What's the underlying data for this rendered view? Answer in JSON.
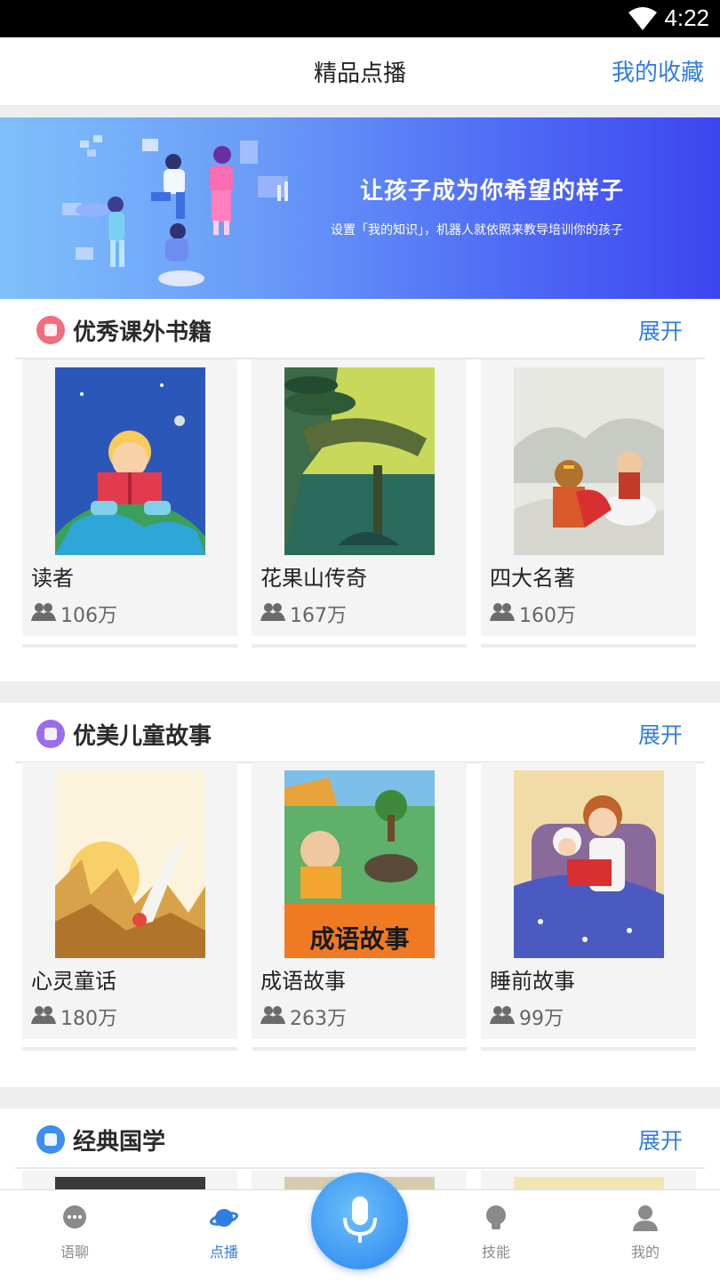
{
  "status_bar": {
    "time": "4:22"
  },
  "header": {
    "title": "精品点播",
    "favorites_label": "我的收藏"
  },
  "banner": {
    "headline": "让孩子成为你希望的样子",
    "subtitle": "设置「我的知识」，机器人就依照来教导培训你的孩子"
  },
  "sections": [
    {
      "title": "优秀课外书籍",
      "more_label": "展开",
      "icon_color": "#f26d7d",
      "items": [
        {
          "name": "读者",
          "count": "106万"
        },
        {
          "name": "花果山传奇",
          "count": "167万"
        },
        {
          "name": "四大名著",
          "count": "160万"
        }
      ]
    },
    {
      "title": "优美儿童故事",
      "more_label": "展开",
      "icon_color": "#9b6cf0",
      "items": [
        {
          "name": "心灵童话",
          "count": "180万"
        },
        {
          "name": "成语故事",
          "count": "263万",
          "cover_text": "成语故事"
        },
        {
          "name": "睡前故事",
          "count": "99万"
        }
      ]
    },
    {
      "title": "经典国学",
      "more_label": "展开",
      "icon_color": "#3d8ef0"
    }
  ],
  "bottom_nav": {
    "items": [
      {
        "label": "语聊",
        "icon": "chat-bubble-icon",
        "active": false
      },
      {
        "label": "点播",
        "icon": "planet-icon",
        "active": true
      },
      {
        "label": "技能",
        "icon": "lightbulb-icon",
        "active": false
      },
      {
        "label": "我的",
        "icon": "person-icon",
        "active": false
      }
    ],
    "center_button": {
      "icon": "microphone-icon"
    }
  },
  "colors": {
    "accent": "#2f7de1",
    "banner_start": "#7fc0fb",
    "banner_end": "#3d45ef"
  }
}
